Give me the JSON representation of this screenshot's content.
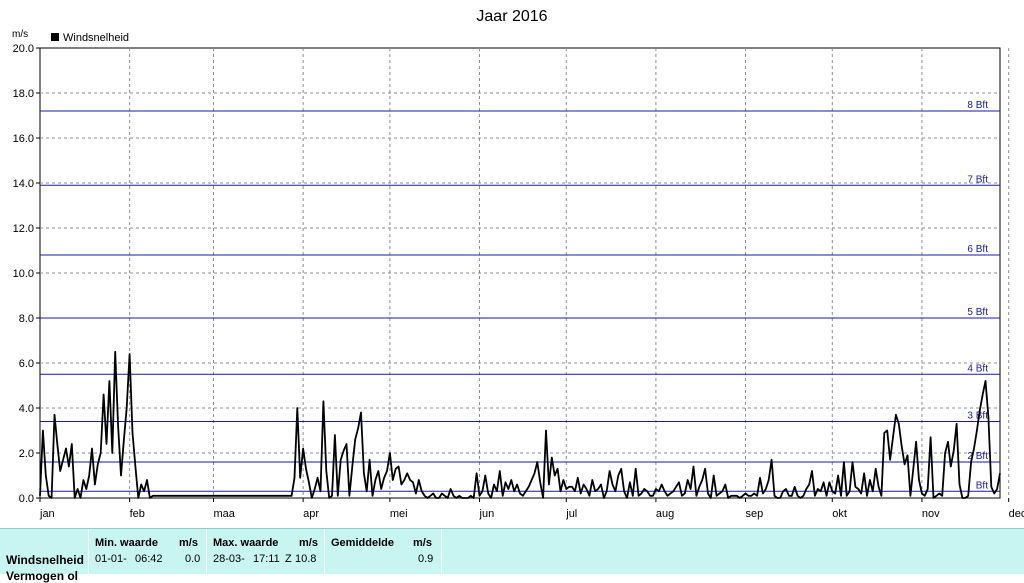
{
  "chart_data": {
    "type": "line",
    "title": "Jaar 2016",
    "ylabel": "m/s",
    "ylim": [
      0,
      20
    ],
    "yticks": [
      "0.0",
      "2.0",
      "4.0",
      "6.0",
      "8.0",
      "10.0",
      "12.0",
      "14.0",
      "16.0",
      "18.0",
      "20.0"
    ],
    "months": [
      "jan",
      "feb",
      "maa",
      "apr",
      "mei",
      "jun",
      "jul",
      "aug",
      "sep",
      "okt",
      "nov",
      "dec"
    ],
    "legend": "Windsnelheid",
    "grid": true,
    "beaufort": [
      {
        "label": "Bft",
        "value": 0.3
      },
      {
        "label": "2 Bft",
        "value": 1.6
      },
      {
        "label": "3 Bft",
        "value": 3.4
      },
      {
        "label": "4 Bft",
        "value": 5.5
      },
      {
        "label": "5 Bft",
        "value": 8.0
      },
      {
        "label": "6 Bft",
        "value": 10.8
      },
      {
        "label": "7 Bft",
        "value": 13.9
      },
      {
        "label": "8 Bft",
        "value": 17.2
      }
    ],
    "series": [
      {
        "name": "Windsnelheid",
        "day_values": [
          0.1,
          3.0,
          1.0,
          0.1,
          0.0,
          3.7,
          2.4,
          1.2,
          1.7,
          2.2,
          1.4,
          2.4,
          0.0,
          0.4,
          0.0,
          0.8,
          0.4,
          1.0,
          2.2,
          0.6,
          1.5,
          2.0,
          4.6,
          2.4,
          5.2,
          2.0,
          6.5,
          3.2,
          1.0,
          2.6,
          4.0,
          6.4,
          2.9,
          1.4,
          0.0,
          0.6,
          0.3,
          0.8,
          0.0,
          0.1,
          0.1,
          0.1,
          0.1,
          0.1,
          0.1,
          0.1,
          0.1,
          0.1,
          0.1,
          0.1,
          0.1,
          0.1,
          0.1,
          0.1,
          0.1,
          0.1,
          0.1,
          0.1,
          0.1,
          0.1,
          0.1,
          0.1,
          0.1,
          0.1,
          0.1,
          0.1,
          0.1,
          0.1,
          0.1,
          0.1,
          0.1,
          0.1,
          0.1,
          0.1,
          0.1,
          0.1,
          0.1,
          0.1,
          0.1,
          0.1,
          0.1,
          0.1,
          0.1,
          0.1,
          0.1,
          0.1,
          0.1,
          0.1,
          0.9,
          4.0,
          0.9,
          2.2,
          1.3,
          0.7,
          0.0,
          0.4,
          0.9,
          0.3,
          4.3,
          1.2,
          0.0,
          0.1,
          2.8,
          0.1,
          1.7,
          2.1,
          2.4,
          0.1,
          1.4,
          2.6,
          3.1,
          3.8,
          1.1,
          0.3,
          1.7,
          0.1,
          0.8,
          1.2,
          0.4,
          0.9,
          1.2,
          2.0,
          0.8,
          1.3,
          1.4,
          0.6,
          0.8,
          1.1,
          0.8,
          0.7,
          0.2,
          0.8,
          0.3,
          0.1,
          0.0,
          0.1,
          0.2,
          0.0,
          0.0,
          0.2,
          0.1,
          0.0,
          0.4,
          0.1,
          0.0,
          0.1,
          0.0,
          0.0,
          0.0,
          0.1,
          0.0,
          1.1,
          0.1,
          0.3,
          1.0,
          0.2,
          0.0,
          0.6,
          0.3,
          1.2,
          0.1,
          0.7,
          0.4,
          0.8,
          0.3,
          0.6,
          0.2,
          0.1,
          0.3,
          0.5,
          0.8,
          1.1,
          1.6,
          0.7,
          0.0,
          3.0,
          0.6,
          1.8,
          1.0,
          1.3,
          0.3,
          0.8,
          0.4,
          0.5,
          0.5,
          0.3,
          0.9,
          0.2,
          0.6,
          0.4,
          0.1,
          0.8,
          0.3,
          0.4,
          0.6,
          0.0,
          0.3,
          1.2,
          0.6,
          0.3,
          1.0,
          1.3,
          0.3,
          0.0,
          0.7,
          0.1,
          1.3,
          0.1,
          0.2,
          0.4,
          0.3,
          0.1,
          0.1,
          0.4,
          0.3,
          0.6,
          0.3,
          0.1,
          0.2,
          0.3,
          0.5,
          0.7,
          0.1,
          0.2,
          0.8,
          0.4,
          1.4,
          0.1,
          0.5,
          0.8,
          1.3,
          0.2,
          0.0,
          1.0,
          0.1,
          0.2,
          0.3,
          0.6,
          0.0,
          0.1,
          0.1,
          0.1,
          0.0,
          0.1,
          0.2,
          0.1,
          0.1,
          0.2,
          0.1,
          0.9,
          0.2,
          0.4,
          0.8,
          1.7,
          0.1,
          0.0,
          0.0,
          0.3,
          0.4,
          0.1,
          0.1,
          0.5,
          0.1,
          0.0,
          0.1,
          0.4,
          0.6,
          1.2,
          0.1,
          0.4,
          0.3,
          0.7,
          0.1,
          0.7,
          0.3,
          0.2,
          1.0,
          0.1,
          1.6,
          0.1,
          0.3,
          1.6,
          0.5,
          0.4,
          0.2,
          1.1,
          0.1,
          0.8,
          0.3,
          1.3,
          0.5,
          0.1,
          2.9,
          3.0,
          1.7,
          2.7,
          3.7,
          3.3,
          2.3,
          1.5,
          1.9,
          0.1,
          1.3,
          2.5,
          0.8,
          0.2,
          0.1,
          0.4,
          2.7,
          0.0,
          0.1,
          0.2,
          0.1,
          2.0,
          2.5,
          1.4,
          2.1,
          3.3,
          0.6,
          0.0,
          0.0,
          0.1,
          1.6,
          2.2,
          3.0,
          3.9,
          4.6,
          5.2,
          3.6,
          0.5,
          0.2,
          0.4,
          1.1
        ]
      }
    ]
  },
  "stats": {
    "row_label": "Windsnelheid",
    "row_label_2": "Vermogen ol",
    "min_header": "Min. waarde",
    "min_unit": "m/s",
    "min_date": "01-01-",
    "min_time": "06:42",
    "min_value": "0.0",
    "max_header": "Max. waarde",
    "max_unit": "m/s",
    "max_date": "28-03-",
    "max_time": "17:11",
    "max_dir": "Z",
    "max_value": "10.8",
    "avg_header": "Gemiddelde",
    "avg_unit": "m/s",
    "avg_value": "0.9"
  },
  "colors": {
    "series": "#000000",
    "beaufort": "#1a1aa0",
    "grid": "#8c8c8c",
    "stats_bg": "#c8f4f2"
  }
}
